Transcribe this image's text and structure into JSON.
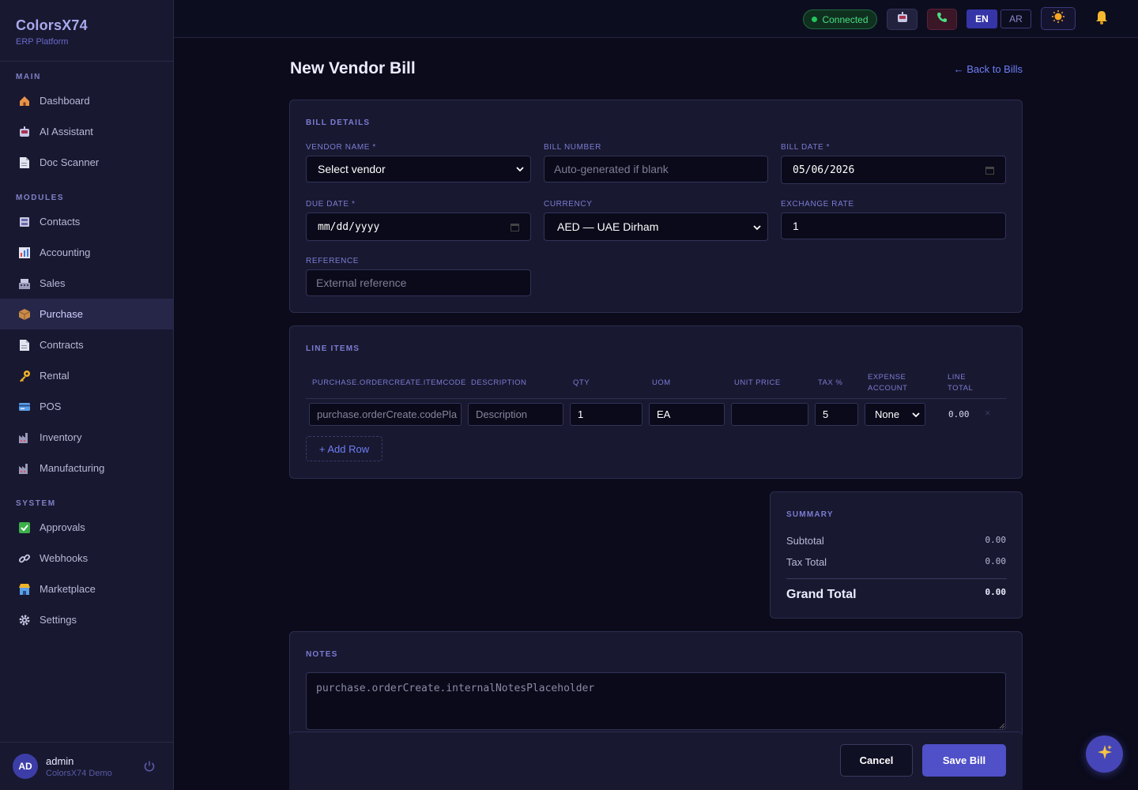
{
  "brand": {
    "name": "ColorsX74",
    "subtitle": "ERP Platform"
  },
  "sidebar": {
    "sections": [
      {
        "title": "MAIN",
        "items": [
          {
            "label": "Dashboard",
            "icon": "house-icon"
          },
          {
            "label": "AI Assistant",
            "icon": "robot-icon"
          },
          {
            "label": "Doc Scanner",
            "icon": "document-icon"
          }
        ]
      },
      {
        "title": "MODULES",
        "items": [
          {
            "label": "Contacts",
            "icon": "contacts-icon"
          },
          {
            "label": "Accounting",
            "icon": "chart-icon"
          },
          {
            "label": "Sales",
            "icon": "register-icon"
          },
          {
            "label": "Purchase",
            "icon": "package-icon",
            "active": true
          },
          {
            "label": "Contracts",
            "icon": "document-icon"
          },
          {
            "label": "Rental",
            "icon": "key-icon"
          },
          {
            "label": "POS",
            "icon": "card-icon"
          },
          {
            "label": "Inventory",
            "icon": "factory-icon"
          },
          {
            "label": "Manufacturing",
            "icon": "factory-icon"
          }
        ]
      },
      {
        "title": "SYSTEM",
        "items": [
          {
            "label": "Approvals",
            "icon": "check-icon"
          },
          {
            "label": "Webhooks",
            "icon": "link-icon"
          },
          {
            "label": "Marketplace",
            "icon": "store-icon"
          },
          {
            "label": "Settings",
            "icon": "gear-icon"
          }
        ]
      }
    ],
    "user": {
      "initials": "AD",
      "name": "admin",
      "org": "ColorsX74 Demo"
    }
  },
  "topbar": {
    "status": "Connected",
    "lang_en": "EN",
    "lang_ar": "AR"
  },
  "page": {
    "title": "New Vendor Bill",
    "back_link": "← Back to Bills"
  },
  "bill_details": {
    "title": "BILL DETAILS",
    "vendor_label": "VENDOR NAME *",
    "vendor_value": "Select vendor",
    "bill_number_label": "BILL NUMBER",
    "bill_number_placeholder": "Auto-generated if blank",
    "bill_date_label": "BILL DATE *",
    "bill_date_value": "05/06/2026",
    "due_date_label": "DUE DATE *",
    "due_date_placeholder": "mm/dd/yyyy",
    "currency_label": "CURRENCY",
    "currency_value": "AED — UAE Dirham",
    "exchange_rate_label": "EXCHANGE RATE",
    "exchange_rate_value": "1",
    "reference_label": "REFERENCE",
    "reference_placeholder": "External reference"
  },
  "line_items": {
    "title": "LINE ITEMS",
    "headers": {
      "item_code": "PURCHASE.ORDERCREATE.ITEMCODE",
      "description": "DESCRIPTION",
      "qty": "QTY",
      "uom": "UOM",
      "unit_price": "UNIT PRICE",
      "tax": "TAX %",
      "expense_1": "EXPENSE",
      "expense_2": "ACCOUNT",
      "total_1": "LINE",
      "total_2": "TOTAL"
    },
    "rows": [
      {
        "item_code_placeholder": "purchase.orderCreate.codePla",
        "description_placeholder": "Description",
        "qty": "1",
        "uom": "EA",
        "unit_price": "",
        "tax": "5",
        "expense_account": "None",
        "line_total": "0.00",
        "remove": "×"
      }
    ],
    "add_row_label": "+ Add Row"
  },
  "summary": {
    "title": "SUMMARY",
    "subtotal_label": "Subtotal",
    "subtotal_value": "0.00",
    "tax_label": "Tax Total",
    "tax_value": "0.00",
    "grand_label": "Grand Total",
    "grand_value": "0.00"
  },
  "notes": {
    "title": "NOTES",
    "placeholder": "purchase.orderCreate.internalNotesPlaceholder"
  },
  "actions": {
    "cancel": "Cancel",
    "save": "Save Bill"
  },
  "colors": {
    "accent": "#5050c8",
    "connected": "#22c55e",
    "link": "#6f7ff5"
  }
}
